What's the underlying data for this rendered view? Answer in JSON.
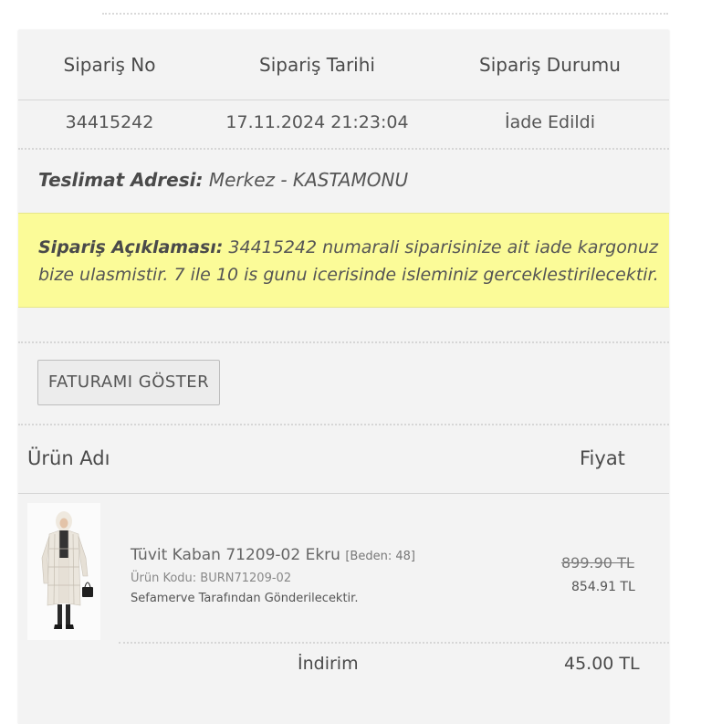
{
  "order_table": {
    "headers": [
      "Sipariş No",
      "Sipariş Tarihi",
      "Sipariş Durumu"
    ],
    "row": {
      "order_no": "34415242",
      "order_date": "17.11.2024 21:23:04",
      "status": "İade Edildi"
    }
  },
  "delivery": {
    "label": "Teslimat Adresi:",
    "value": "Merkez - KASTAMONU"
  },
  "order_note": {
    "label": "Sipariş Açıklaması:",
    "text": "34415242 numarali siparisinize ait iade kargonuz bize ulasmistir. 7 ile 10 is gunu icerisinde isleminiz gerceklestirilecektir."
  },
  "invoice_button": {
    "label": "FATURAMI GÖSTER"
  },
  "products_table": {
    "header_name": "Ürün Adı",
    "header_price": "Fiyat",
    "items": [
      {
        "title": "Tüvit Kaban 71209-02 Ekru",
        "size": "[Beden: 48]",
        "code": "Ürün Kodu: BURN71209-02",
        "seller": "Sefamerve Tarafından Gönderilecektir.",
        "old_price": "899.90 TL",
        "price": "854.91 TL"
      }
    ]
  },
  "summary": {
    "discount_label": "İndirim",
    "discount_value": "45.00 TL"
  },
  "colors": {
    "note_background": "#fbfb98",
    "card_background": "#f3f3f3"
  }
}
